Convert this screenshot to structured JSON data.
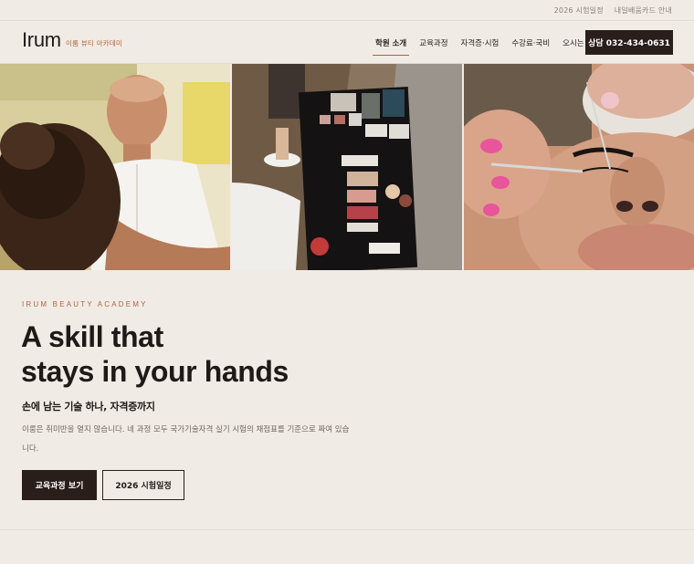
{
  "util_bar": {
    "links": [
      "2026 시험일정",
      "내일배움카드 안내"
    ]
  },
  "header": {
    "logo": "Irum",
    "logo_sub": "이룸 뷰티 아카데미",
    "nav": [
      {
        "label": "학원 소개",
        "active": true
      },
      {
        "label": "교육과정",
        "active": false
      },
      {
        "label": "자격증·시험",
        "active": false
      },
      {
        "label": "수강료·국비",
        "active": false
      },
      {
        "label": "오시는 길",
        "active": false
      }
    ],
    "cta": "상담 032-434-0631"
  },
  "hero": {
    "eyebrow": "IRUM BEAUTY ACADEMY",
    "headline_line1": "A skill that",
    "headline_line2": "stays in your hands",
    "subhead": "손에 남는 기술 하나, 자격증까지",
    "description": "이룸은 취미반을 열지 않습니다. 네 과정 모두 국가기술자격 실기 시험의 채점표를 기준으로 짜여 있습니다.",
    "primary_button": "교육과정 보기",
    "secondary_button": "2026 시험일정"
  },
  "colors": {
    "background": "#f1ebe6",
    "accent": "#b0643a",
    "dark": "#2a1e1b"
  }
}
